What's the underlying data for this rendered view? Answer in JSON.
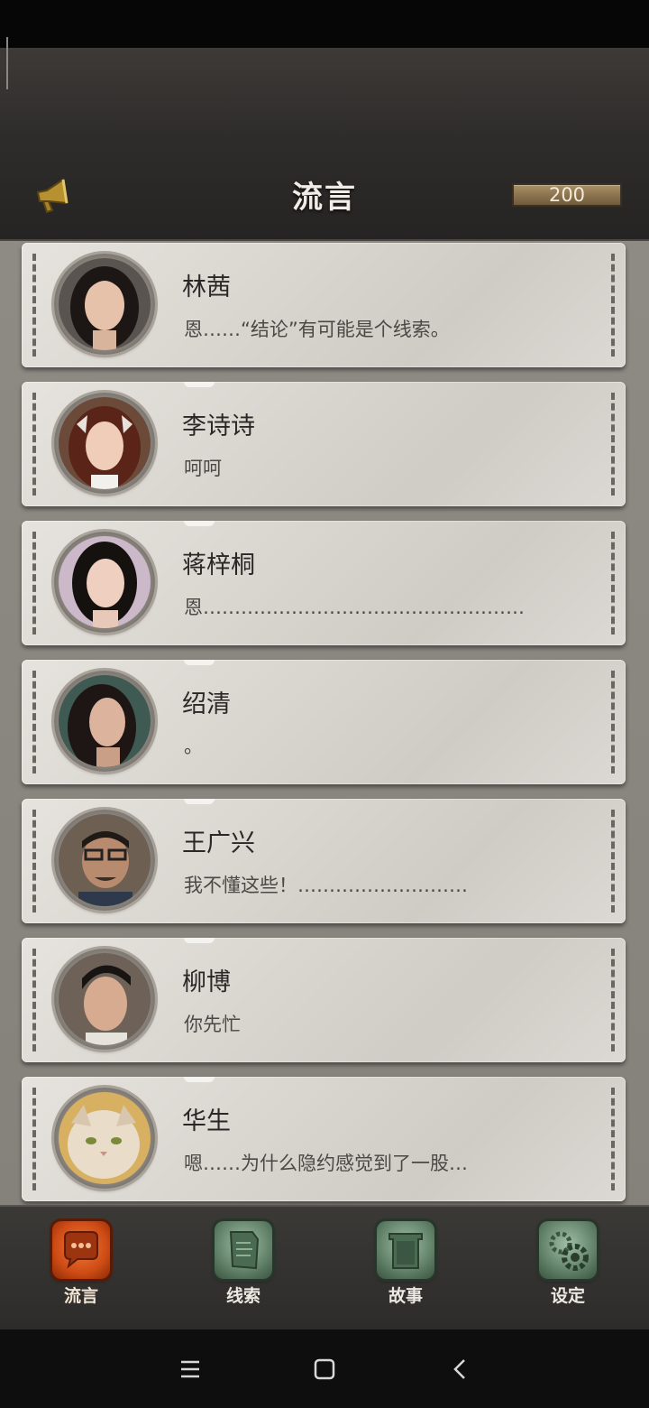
{
  "header": {
    "title": "流言",
    "coins": "200"
  },
  "contacts": [
    {
      "name": "林茜",
      "message": "恩……“结论”有可能是个线索。"
    },
    {
      "name": "李诗诗",
      "message": "呵呵"
    },
    {
      "name": "蒋梓桐",
      "message": "恩……………………………………………"
    },
    {
      "name": "绍清",
      "message": "。"
    },
    {
      "name": "王广兴",
      "message": "我不懂这些！………………………"
    },
    {
      "name": "柳博",
      "message": "你先忙"
    },
    {
      "name": "华生",
      "message": "嗯……为什么隐约感觉到了一股…"
    }
  ],
  "tabs": [
    {
      "label": "流言",
      "icon": "chat-bubble-icon",
      "active": true
    },
    {
      "label": "线索",
      "icon": "paper-note-icon",
      "active": false
    },
    {
      "label": "故事",
      "icon": "book-icon",
      "active": false
    },
    {
      "label": "设定",
      "icon": "gear-icon",
      "active": false
    }
  ],
  "colors": {
    "accent": "#cf4c15",
    "tab_inactive": "#66876d",
    "coin_bar": "#8c7450",
    "card": "#dcd9d4"
  }
}
